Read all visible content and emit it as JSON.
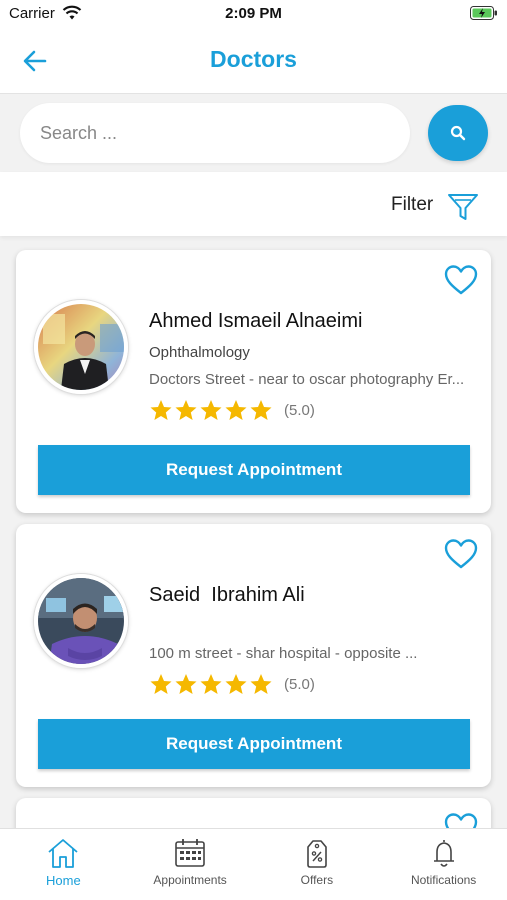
{
  "status_bar": {
    "carrier": "Carrier",
    "time": "2:09 PM"
  },
  "nav": {
    "title": "Doctors"
  },
  "search": {
    "placeholder": "Search ..."
  },
  "filter": {
    "label": "Filter"
  },
  "doctors": [
    {
      "name": "Ahmed Ismaeil Alnaeimi",
      "specialty": "Ophthalmology",
      "address": "Doctors Street - near to oscar photography Er...",
      "rating": "(5.0)",
      "stars": 5,
      "button": "Request Appointment"
    },
    {
      "name": "Saeid  Ibrahim Ali",
      "specialty": "",
      "address": "100 m street - shar hospital - opposite ...",
      "rating": "(5.0)",
      "stars": 5,
      "button": "Request Appointment"
    }
  ],
  "tabs": [
    {
      "label": "Home",
      "icon": "home-icon",
      "active": true
    },
    {
      "label": "Appointments",
      "icon": "calendar-icon",
      "active": false
    },
    {
      "label": "Offers",
      "icon": "offers-tag-icon",
      "active": false
    },
    {
      "label": "Notifications",
      "icon": "bell-icon",
      "active": false
    }
  ],
  "colors": {
    "accent": "#1a9fd9",
    "star": "#f5b800"
  }
}
